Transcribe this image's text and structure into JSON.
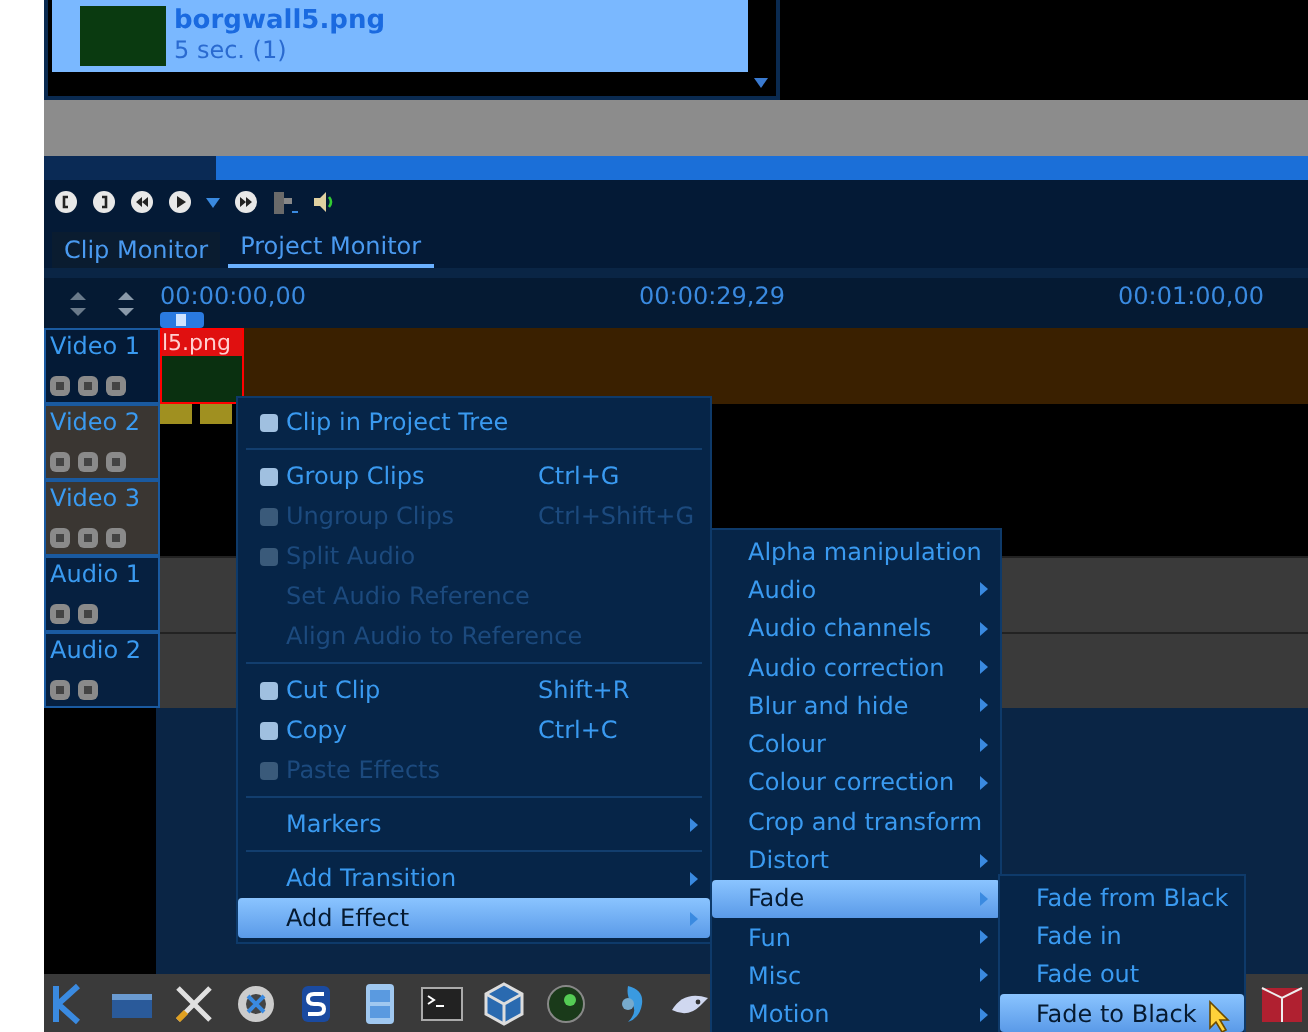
{
  "bin": {
    "items": [
      {
        "name": "borgwall5.png",
        "duration": "5 sec. (1)",
        "selected": true
      }
    ]
  },
  "monitor_tabs": [
    {
      "label": "Clip Monitor",
      "selected": false
    },
    {
      "label": "Project Monitor",
      "selected": true
    }
  ],
  "ruler": {
    "timecodes": [
      "00:00:00,00",
      "00:00:29,29",
      "00:01:00,00"
    ]
  },
  "tracks": [
    {
      "name": "Video 1",
      "kind": "video"
    },
    {
      "name": "Video 2",
      "kind": "video"
    },
    {
      "name": "Video 3",
      "kind": "video"
    },
    {
      "name": "Audio 1",
      "kind": "audio"
    },
    {
      "name": "Audio 2",
      "kind": "audio"
    }
  ],
  "clip": {
    "label": "l5.png"
  },
  "context_menu": [
    {
      "kind": "item",
      "label": "Clip in Project Tree",
      "icon": true,
      "disabled": false,
      "submenu": false,
      "selected": false
    },
    {
      "kind": "separator"
    },
    {
      "kind": "item",
      "label": "Group Clips",
      "shortcut": "Ctrl+G",
      "icon": true,
      "disabled": false,
      "submenu": false,
      "selected": false
    },
    {
      "kind": "item",
      "label": "Ungroup Clips",
      "shortcut": "Ctrl+Shift+G",
      "icon": true,
      "disabled": true,
      "submenu": false,
      "selected": false
    },
    {
      "kind": "item",
      "label": "Split Audio",
      "icon": true,
      "disabled": true,
      "submenu": false,
      "selected": false
    },
    {
      "kind": "item",
      "label": "Set Audio Reference",
      "disabled": true,
      "submenu": false,
      "selected": false
    },
    {
      "kind": "item",
      "label": "Align Audio to Reference",
      "disabled": true,
      "submenu": false,
      "selected": false
    },
    {
      "kind": "separator"
    },
    {
      "kind": "item",
      "label": "Cut Clip",
      "shortcut": "Shift+R",
      "icon": true,
      "disabled": false,
      "submenu": false,
      "selected": false
    },
    {
      "kind": "item",
      "label": "Copy",
      "shortcut": "Ctrl+C",
      "icon": true,
      "disabled": false,
      "submenu": false,
      "selected": false
    },
    {
      "kind": "item",
      "label": "Paste Effects",
      "icon": true,
      "disabled": true,
      "submenu": false,
      "selected": false
    },
    {
      "kind": "separator"
    },
    {
      "kind": "item",
      "label": "Markers",
      "disabled": false,
      "submenu": true,
      "selected": false
    },
    {
      "kind": "separator"
    },
    {
      "kind": "item",
      "label": "Add Transition",
      "disabled": false,
      "submenu": true,
      "selected": false
    },
    {
      "kind": "item",
      "label": "Add Effect",
      "disabled": false,
      "submenu": true,
      "selected": true
    }
  ],
  "effects_menu": [
    {
      "label": "Alpha manipulation",
      "selected": false
    },
    {
      "label": "Audio",
      "selected": false
    },
    {
      "label": "Audio channels",
      "selected": false
    },
    {
      "label": "Audio correction",
      "selected": false
    },
    {
      "label": "Blur and hide",
      "selected": false
    },
    {
      "label": "Colour",
      "selected": false
    },
    {
      "label": "Colour correction",
      "selected": false
    },
    {
      "label": "Crop and transform",
      "selected": false
    },
    {
      "label": "Distort",
      "selected": false
    },
    {
      "label": "Fade",
      "selected": true
    },
    {
      "label": "Fun",
      "selected": false
    },
    {
      "label": "Misc",
      "selected": false
    },
    {
      "label": "Motion",
      "selected": false
    }
  ],
  "fade_menu": [
    {
      "label": "Fade from Black",
      "selected": false
    },
    {
      "label": "Fade in",
      "selected": false
    },
    {
      "label": "Fade out",
      "selected": false
    },
    {
      "label": "Fade to Black",
      "selected": true
    }
  ]
}
